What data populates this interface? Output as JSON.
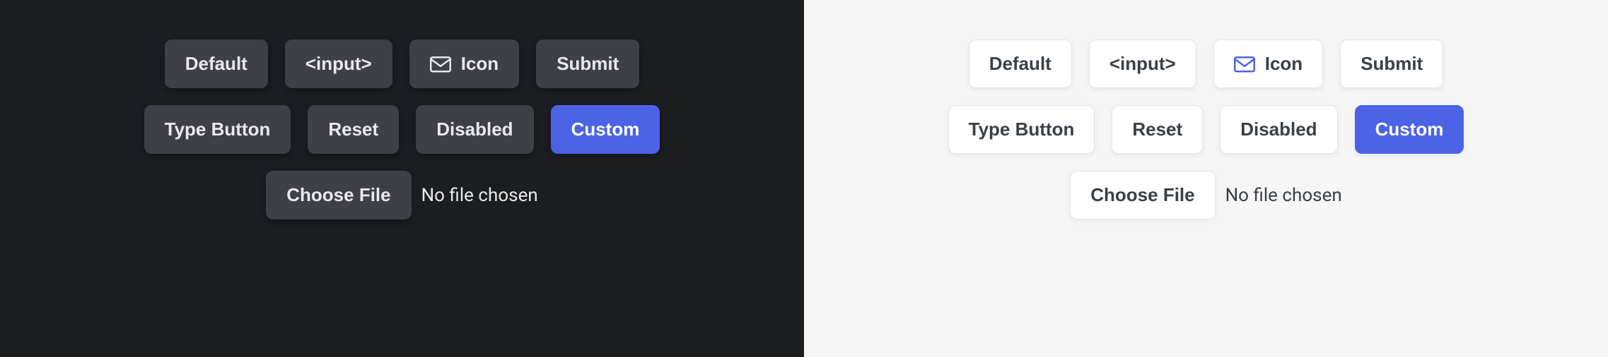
{
  "buttons": {
    "default": "Default",
    "input": "<input>",
    "icon": "Icon",
    "submit": "Submit",
    "type_button": "Type Button",
    "reset": "Reset",
    "disabled": "Disabled",
    "custom": "Custom",
    "choose_file": "Choose File"
  },
  "file_status": "No file chosen",
  "colors": {
    "accent": "#4c63e6",
    "dark_bg": "#1b1d21",
    "dark_btn": "#3d4047",
    "light_bg": "#f6f6f7",
    "light_btn": "#ffffff"
  }
}
